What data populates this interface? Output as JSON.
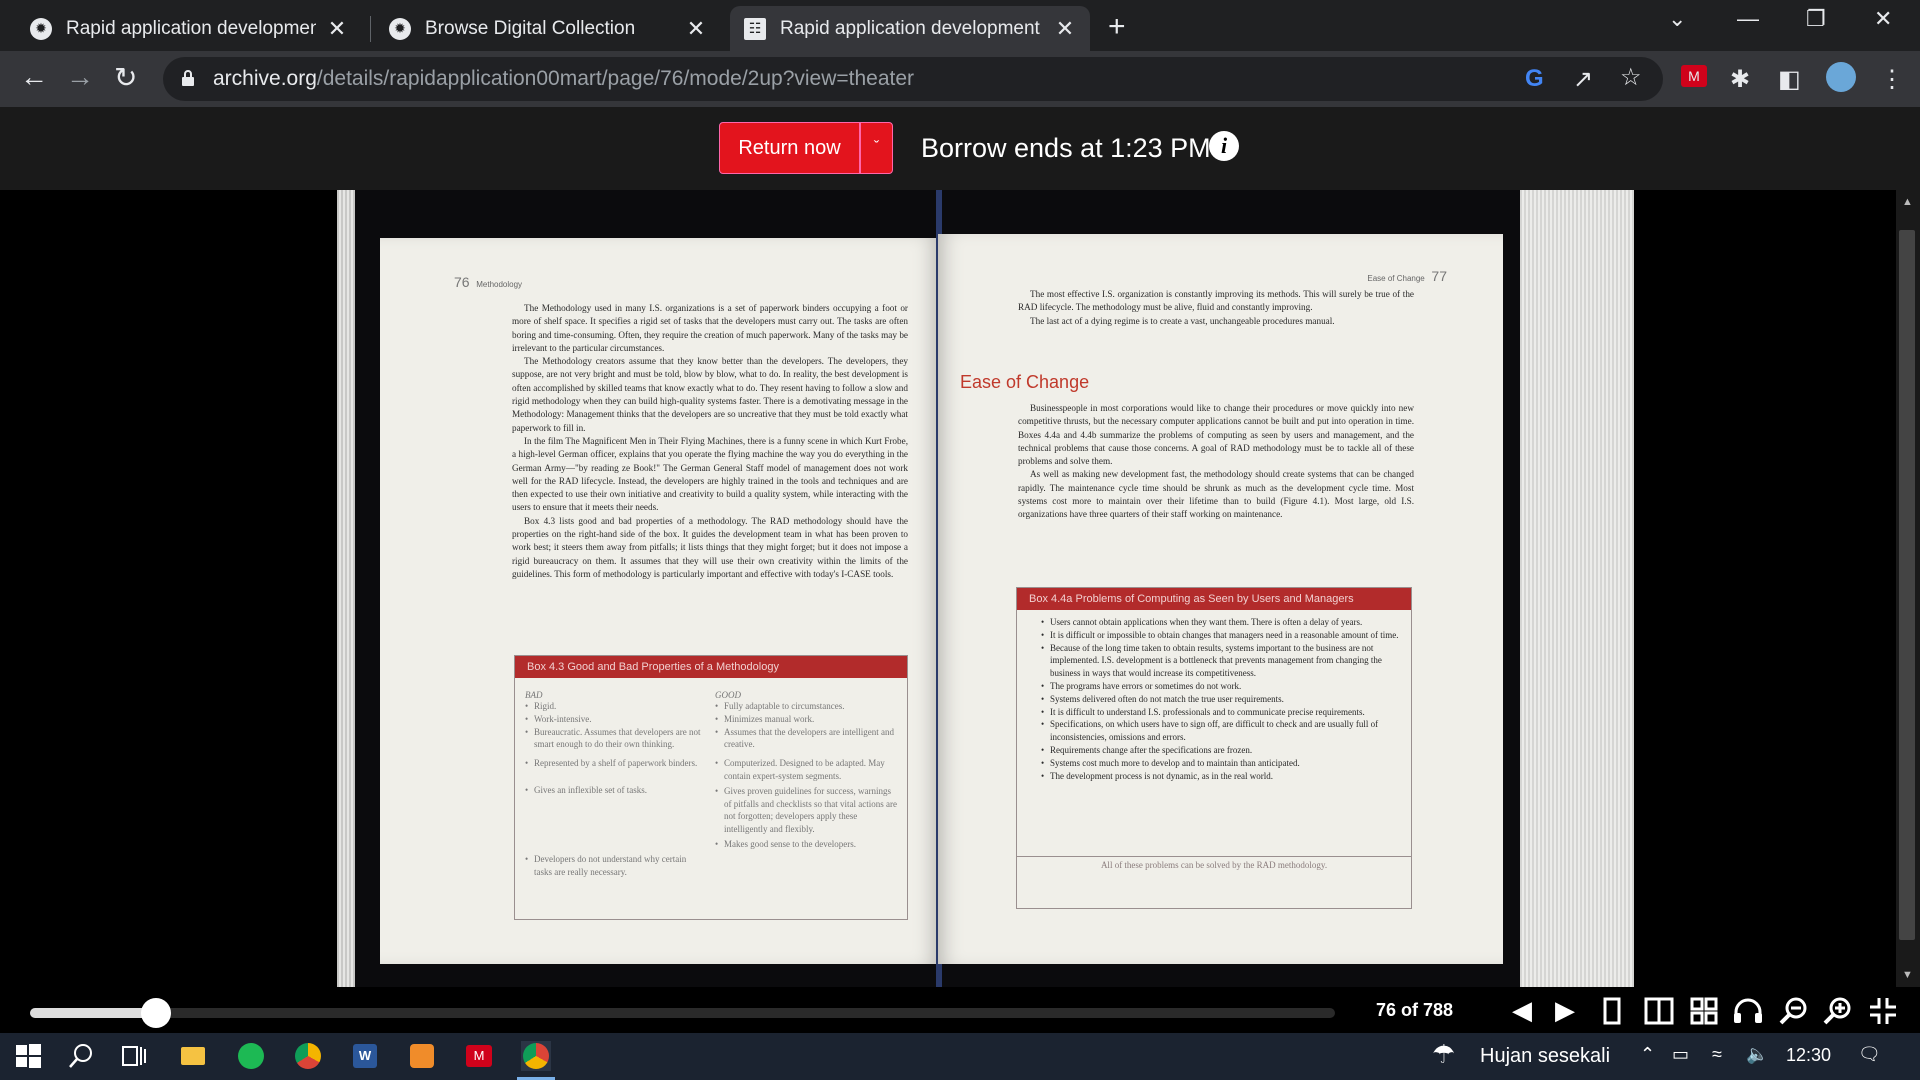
{
  "browser": {
    "tabs": [
      {
        "title": "Rapid application development: |",
        "active": false
      },
      {
        "title": "Browse Digital Collection",
        "active": false
      },
      {
        "title": "Rapid application development :",
        "active": true
      }
    ],
    "url_domain": "archive.org",
    "url_path": "/details/rapidapplication00mart/page/76/mode/2up?view=theater"
  },
  "borrow": {
    "return_label": "Return now",
    "dropdown_glyph": "ˇ",
    "borrow_text": "Borrow ends at 1:23 PM",
    "info_glyph": "i"
  },
  "book": {
    "left_page": {
      "number": "76",
      "running_head": "Methodology",
      "paragraphs": [
        "The Methodology used in many I.S. organizations is a set of paperwork binders occupying a foot or more of shelf space. It specifies a rigid set of tasks that the developers must carry out. The tasks are often boring and time-consuming. Often, they require the creation of much paperwork. Many of the tasks may be irrelevant to the particular circumstances.",
        "The Methodology creators assume that they know better than the developers. The developers, they suppose, are not very bright and must be told, blow by blow, what to do. In reality, the best development is often accomplished by skilled teams that know exactly what to do. They resent having to follow a slow and rigid methodology when they can build high-quality systems faster. There is a demotivating message in the Methodology: Management thinks that the developers are so uncreative that they must be told exactly what paperwork to fill in.",
        "In the film The Magnificent Men in Their Flying Machines, there is a funny scene in which Kurt Frobe, a high-level German officer, explains that you operate the flying machine the way you do everything in the German Army—\"by reading ze Book!\" The German General Staff model of management does not work well for the RAD lifecycle. Instead, the developers are highly trained in the tools and techniques and are then expected to use their own initiative and creativity to build a quality system, while interacting with the users to ensure that it meets their needs.",
        "Box 4.3 lists good and bad properties of a methodology. The RAD methodology should have the properties on the right-hand side of the box. It guides the development team in what has been proven to work best; it steers them away from pitfalls; it lists things that they might forget; but it does not impose a rigid bureaucracy on them. It assumes that they will use their own creativity within the limits of the guidelines. This form of methodology is particularly important and effective with today's I-CASE tools."
      ],
      "box": {
        "title": "Box 4.3   Good and Bad Properties of a Methodology",
        "bad_head": "BAD",
        "good_head": "GOOD",
        "bad": [
          "Rigid.",
          "Work-intensive.",
          "Bureaucratic. Assumes that developers are not smart enough to do their own thinking.",
          "Represented by a shelf of paperwork binders.",
          "Gives an inflexible set of tasks.",
          "Developers do not understand why certain tasks are really necessary."
        ],
        "good": [
          "Fully adaptable to circumstances.",
          "Minimizes manual work.",
          "Assumes that the developers are intelligent and creative.",
          "Computerized. Designed to be adapted. May contain expert-system segments.",
          "Gives proven guidelines for success, warnings of pitfalls and checklists so that vital actions are not forgotten; developers apply these intelligently and flexibly.",
          "Makes good sense to the developers."
        ]
      }
    },
    "right_page": {
      "number": "77",
      "running_head": "Ease of Change",
      "intro": [
        "The most effective I.S. organization is constantly improving its methods. This will surely be true of the RAD lifecycle. The methodology must be alive, fluid and constantly improving.",
        "The last act of a dying regime is to create a vast, unchangeable procedures manual."
      ],
      "heading": "Ease of Change",
      "paragraphs": [
        "Businesspeople in most corporations would like to change their procedures or move quickly into new competitive thrusts, but the necessary computer applications cannot be built and put into operation in time. Boxes 4.4a and 4.4b summarize the problems of computing as seen by users and management, and the technical problems that cause those concerns. A goal of RAD methodology must be to tackle all of these problems and solve them.",
        "As well as making new development fast, the methodology should create systems that can be changed rapidly. The maintenance cycle time should be shrunk as much as the development cycle time. Most systems cost more to maintain over their lifetime than to build (Figure 4.1). Most large, old I.S. organizations have three quarters of their staff working on maintenance."
      ],
      "box": {
        "title": "Box 4.4a   Problems of Computing as Seen by Users and Managers",
        "items": [
          "Users cannot obtain applications when they want them. There is often a delay of years.",
          "It is difficult or impossible to obtain changes that managers need in a reasonable amount of time.",
          "Because of the long time taken to obtain results, systems important to the business are not implemented. I.S. development is a bottleneck that prevents management from changing the business in ways that would increase its competitiveness.",
          "The programs have errors or sometimes do not work.",
          "Systems delivered often do not match the true user requirements.",
          "It is difficult to understand I.S. professionals and to communicate precise requirements.",
          "Specifications, on which users have to sign off, are difficult to check and are usually full of inconsistencies, omissions and errors.",
          "Requirements change after the specifications are frozen.",
          "Systems cost much more to develop and to maintain than anticipated.",
          "The development process is not dynamic, as in the real world."
        ],
        "footer": "All of these problems can be solved by the RAD methodology."
      }
    }
  },
  "reader": {
    "page_indicator": "76 of 788",
    "progress": 0.0965
  },
  "taskbar": {
    "weather": "Hujan sesekali",
    "time": "12:30"
  }
}
